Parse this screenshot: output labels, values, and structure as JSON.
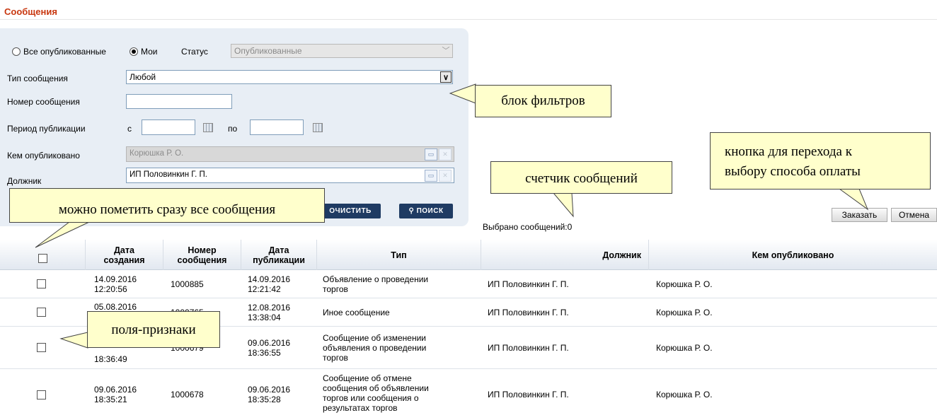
{
  "page_title": "Сообщения",
  "filters": {
    "radio_all": "Все опубликованные",
    "radio_mine": "Мои",
    "status_label": "Статус",
    "status_value": "Опубликованные",
    "type_label": "Тип сообщения",
    "type_value": "Любой",
    "number_label": "Номер сообщения",
    "number_value": "",
    "period_label": "Период публикации",
    "period_from": "с",
    "period_to": "по",
    "published_by_label": "Кем опубликовано",
    "published_by_value": "Корюшка Р. О.",
    "debtor_label": "Должник",
    "debtor_value": "ИП Половинкин Г. П.",
    "clear_button": "ОЧИСТИТЬ",
    "search_button": "ПОИСК"
  },
  "counter": {
    "label": "Выбрано сообщений:",
    "value": "0"
  },
  "actions": {
    "order": "Заказать",
    "cancel": "Отмена"
  },
  "callouts": {
    "filters": "блок фильтров",
    "counter": "счетчик сообщений",
    "order_button": [
      "кнопка для перехода к",
      "выбору способа оплаты"
    ],
    "select_all": "можно пометить сразу все сообщения",
    "checkboxes": "поля-признаки"
  },
  "table": {
    "headers": {
      "created": [
        "Дата",
        "создания"
      ],
      "number": [
        "Номер",
        "сообщения"
      ],
      "published": [
        "Дата",
        "публикации"
      ],
      "type": "Тип",
      "debtor": "Должник",
      "published_by": "Кем опубликовано"
    },
    "rows": [
      {
        "created": [
          "14.09.2016",
          "12:20:56"
        ],
        "number": "1000885",
        "published": [
          "14.09.2016",
          "12:21:42"
        ],
        "type": [
          "Объявление о проведении",
          "торгов"
        ],
        "debtor": "ИП Половинкин Г. П.",
        "published_by": "Корюшка Р. О."
      },
      {
        "created": [
          "05.08.2016",
          ""
        ],
        "number": "1000765",
        "published": [
          "12.08.2016",
          "13:38:04"
        ],
        "type": [
          "Иное сообщение"
        ],
        "debtor": "ИП Половинкин Г. П.",
        "published_by": "Корюшка Р. О."
      },
      {
        "created": [
          "",
          "18:36:49"
        ],
        "number": "1000679",
        "published": [
          "09.06.2016",
          "18:36:55"
        ],
        "type": [
          "Сообщение об изменении",
          "объявления о проведении",
          "торгов"
        ],
        "debtor": "ИП Половинкин Г. П.",
        "published_by": "Корюшка Р. О."
      },
      {
        "created": [
          "09.06.2016",
          "18:35:21"
        ],
        "number": "1000678",
        "published": [
          "09.06.2016",
          "18:35:28"
        ],
        "type": [
          "Сообщение об отмене",
          "сообщения об объявлении",
          "торгов или сообщения о",
          "результатах торгов"
        ],
        "debtor": "ИП Половинкин Г. П.",
        "published_by": "Корюшка Р. О."
      }
    ]
  }
}
